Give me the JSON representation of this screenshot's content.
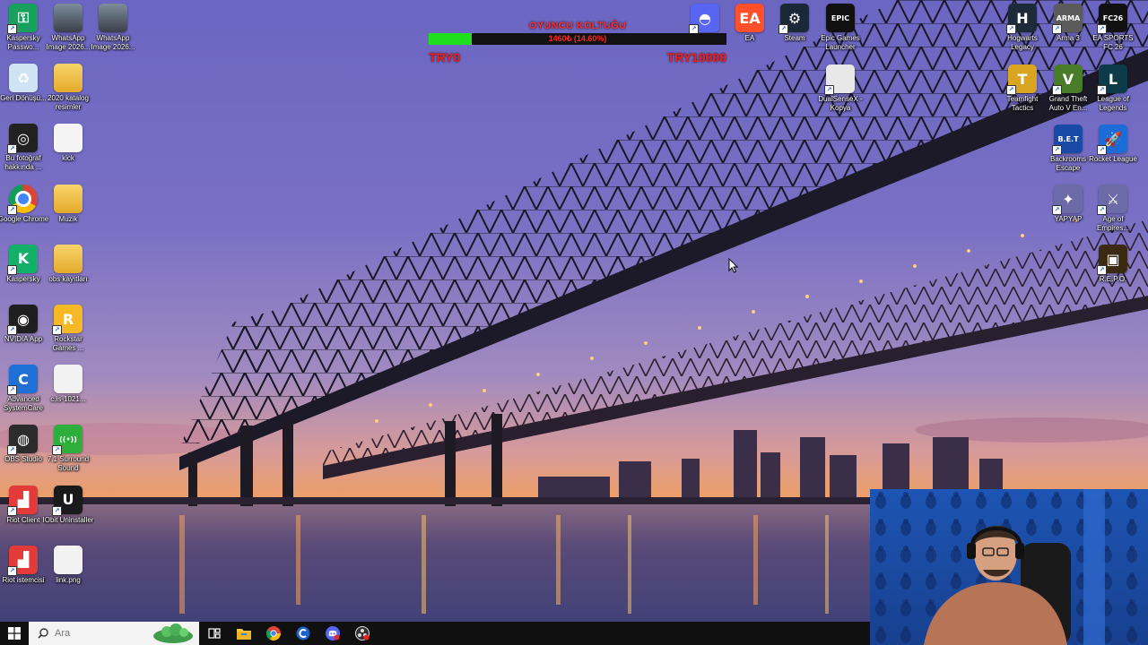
{
  "desktop": {
    "left_icons": [
      {
        "label": "Kaspersky Passwo...",
        "icon": "kaspersky-password-icon",
        "bg": "#18a05e",
        "glyph": "⚿",
        "shortcut": true
      },
      {
        "label": "WhatsApp Image 2026...",
        "icon": "image-file-icon",
        "bg": "photo",
        "glyph": "",
        "shortcut": false
      },
      {
        "label": "WhatsApp Image 2026...",
        "icon": "image-file-icon",
        "bg": "photo",
        "glyph": "",
        "shortcut": false
      },
      {
        "label": "Geri Dönüşü...",
        "icon": "recycle-bin-icon",
        "bg": "#cfe3f5",
        "glyph": "♻",
        "shortcut": false
      },
      {
        "label": "2020 katalog resimler",
        "icon": "folder-icon",
        "bg": "folder",
        "glyph": "",
        "shortcut": false
      },
      {
        "label": "Bu fotoğraf hakkında ...",
        "icon": "photo-info-icon",
        "bg": "#222222",
        "glyph": "◎",
        "shortcut": true
      },
      {
        "label": "kick",
        "icon": "document-icon",
        "bg": "#f4f4f4",
        "glyph": "",
        "shortcut": false
      },
      {
        "label": "Google Chrome",
        "icon": "chrome-icon",
        "bg": "chrome",
        "glyph": "",
        "shortcut": true
      },
      {
        "label": "Muzik",
        "icon": "music-folder-icon",
        "bg": "folder",
        "glyph": "",
        "shortcut": false
      },
      {
        "label": "Kaspersky",
        "icon": "kaspersky-icon",
        "bg": "#13b06a",
        "glyph": "K",
        "shortcut": true
      },
      {
        "label": "obs kayıtları",
        "icon": "folder-icon",
        "bg": "folder",
        "glyph": "",
        "shortcut": false
      },
      {
        "label": "NVIDIA App",
        "icon": "nvidia-icon",
        "bg": "#1f1f1f",
        "glyph": "◉",
        "shortcut": true
      },
      {
        "label": "Rockstar Games ...",
        "icon": "rockstar-icon",
        "bg": "#f6b824",
        "glyph": "R",
        "shortcut": true
      },
      {
        "label": "Advanced SystemCare",
        "icon": "advanced-systemcare-icon",
        "bg": "#1f6fd6",
        "glyph": "C",
        "shortcut": true
      },
      {
        "label": "c.is-1021...",
        "icon": "archive-icon",
        "bg": "#f2f2f2",
        "glyph": "",
        "shortcut": false
      },
      {
        "label": "OBS Studio",
        "icon": "obs-icon",
        "bg": "#2c2c2c",
        "glyph": "◍",
        "shortcut": true
      },
      {
        "label": "7.1 Surround Sound",
        "icon": "surround-sound-icon",
        "bg": "#2eae3a",
        "glyph": "((•))",
        "shortcut": true
      },
      {
        "label": "Riot Client",
        "icon": "riot-client-icon",
        "bg": "#e33a3a",
        "glyph": "▟",
        "shortcut": true
      },
      {
        "label": "IObit Uninstaller",
        "icon": "iobit-uninstaller-icon",
        "bg": "#1a1a1a",
        "glyph": "U",
        "shortcut": true
      },
      {
        "label": "Riot istemcisi",
        "icon": "riot-client-icon",
        "bg": "#e33a3a",
        "glyph": "▟",
        "shortcut": true
      },
      {
        "label": "link.png",
        "icon": "image-file-icon",
        "bg": "#f2f2f2",
        "glyph": "",
        "shortcut": false
      }
    ],
    "top_center_icons": [
      {
        "label": "",
        "icon": "discord-icon",
        "bg": "#5865f2",
        "glyph": "◓",
        "shortcut": true
      },
      {
        "label": "EA",
        "icon": "ea-icon",
        "bg": "#ff4f2b",
        "glyph": "EA",
        "shortcut": false
      },
      {
        "label": "Steam",
        "icon": "steam-icon",
        "bg": "#1b2838",
        "glyph": "⚙",
        "shortcut": true
      },
      {
        "label": "Epic Games Launcher",
        "icon": "epic-games-icon",
        "bg": "#111111",
        "glyph": "EPIC",
        "shortcut": false
      },
      {
        "label": "DualSenseX - Kopya",
        "icon": "dualsensex-icon",
        "bg": "#e8e8e8",
        "glyph": "",
        "shortcut": true
      }
    ],
    "right_icons": [
      {
        "label": "Hogwarts Legacy",
        "icon": "hogwarts-legacy-icon",
        "bg": "#1d2a3a",
        "glyph": "H",
        "shortcut": true
      },
      {
        "label": "Arma 3",
        "icon": "arma3-icon",
        "bg": "#5b5b5b",
        "glyph": "ARMA",
        "shortcut": true
      },
      {
        "label": "EA SPORTS FC 26",
        "icon": "ea-sports-fc-icon",
        "bg": "#111111",
        "glyph": "FC26",
        "shortcut": true
      },
      {
        "label": "Teamfight Tactics",
        "icon": "teamfight-tactics-icon",
        "bg": "#d9a520",
        "glyph": "T",
        "shortcut": true
      },
      {
        "label": "Grand Theft Auto V En...",
        "icon": "gta-v-icon",
        "bg": "#4a7d2a",
        "glyph": "V",
        "shortcut": true
      },
      {
        "label": "League of Legends",
        "icon": "league-of-legends-icon",
        "bg": "#0d3b4a",
        "glyph": "L",
        "shortcut": true
      },
      {
        "label": "Backrooms Escape Together",
        "icon": "backrooms-icon",
        "bg": "#1a4aa8",
        "glyph": "B.E.T",
        "shortcut": true
      },
      {
        "label": "Rocket League",
        "icon": "rocket-league-icon",
        "bg": "#1d6bd6",
        "glyph": "🚀",
        "shortcut": true
      },
      {
        "label": "YAPYAP",
        "icon": "yapyap-icon",
        "bg": "#6d6aa8",
        "glyph": "✦",
        "shortcut": true
      },
      {
        "label": "Age of Empires...",
        "icon": "age-of-empires-icon",
        "bg": "#6d6aa8",
        "glyph": "⚔",
        "shortcut": true
      },
      {
        "label": "R.E.P.O.",
        "icon": "repo-icon",
        "bg": "#3a2a12",
        "glyph": "▣",
        "shortcut": true
      }
    ]
  },
  "goal_widget": {
    "title": "OYUNCU KOLTUĞU",
    "progress_text": "1460₺ (14.60%)",
    "progress_fraction": 0.146,
    "min_label": "TRY0",
    "max_label": "TRY10000",
    "fill_color": "#1ede1e",
    "text_color": "#ff1a1a"
  },
  "taskbar": {
    "search_placeholder": "Ara",
    "pinned": [
      {
        "icon": "task-view-icon"
      },
      {
        "icon": "file-explorer-icon"
      },
      {
        "icon": "chrome-icon"
      },
      {
        "icon": "ccleaner-icon"
      },
      {
        "icon": "discord-icon"
      },
      {
        "icon": "obs-icon"
      }
    ]
  }
}
